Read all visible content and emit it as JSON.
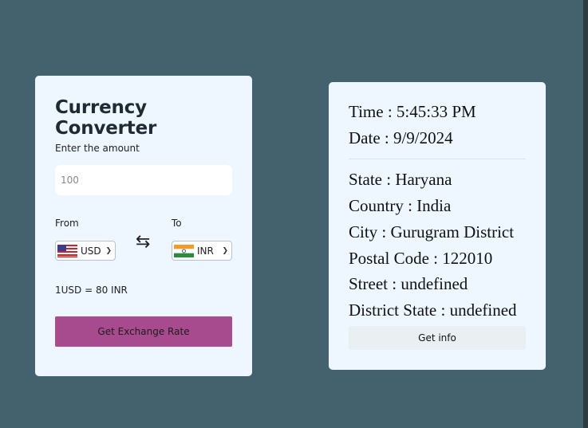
{
  "converter": {
    "title": "Currency Converter",
    "amount_label": "Enter the amount",
    "amount_value": "100",
    "from_label": "From",
    "to_label": "To",
    "from_currency": {
      "code": "USD",
      "flag": "us-flag-icon"
    },
    "to_currency": {
      "code": "INR",
      "flag": "in-flag-icon"
    },
    "rate_text": "1USD = 80 INR",
    "button_label": "Get Exchange Rate",
    "accent_color": "#a84a8e"
  },
  "info": {
    "time": "Time : 5:45:33 PM",
    "date": "Date : 9/9/2024",
    "state": "State : Haryana",
    "country": "Country : India",
    "city": "City : Gurugram District",
    "postal_code": "Postal Code : 122010",
    "street": "Street : undefined",
    "district_state": "District State : undefined",
    "button_label": "Get info"
  },
  "colors": {
    "background": "#44626d",
    "card": "#eef7ff"
  }
}
